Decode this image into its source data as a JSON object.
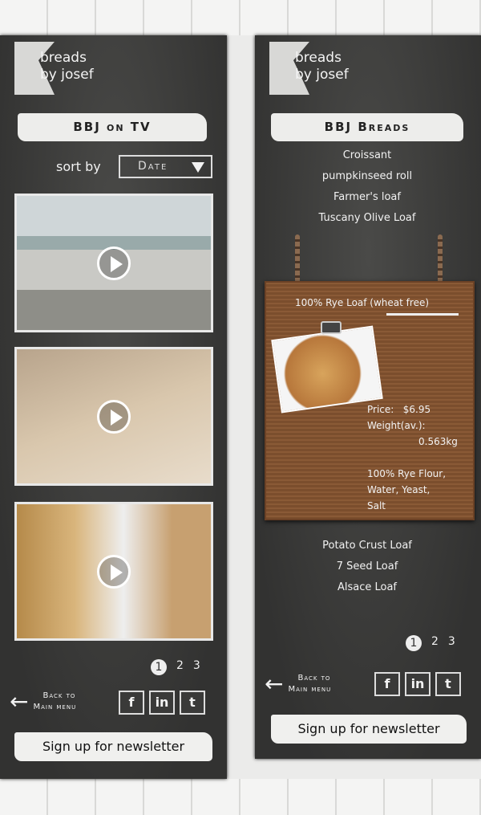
{
  "brand": {
    "line1": "breads",
    "line2": "by josef"
  },
  "screen_tv": {
    "title": "BBJ on TV",
    "sort_label": "sort by",
    "sort_value": "Date",
    "videos": [
      {
        "name": "bakers-kitchen"
      },
      {
        "name": "kneading-dough"
      },
      {
        "name": "baker-in-shop"
      }
    ],
    "pages": [
      "1",
      "2",
      "3"
    ],
    "back_line1": "Back to",
    "back_line2": "Main menu",
    "social": [
      "f",
      "in",
      "t"
    ],
    "newsletter": "Sign up for newsletter"
  },
  "screen_breads": {
    "title": "BBJ Breads",
    "list_top": [
      "Croissant",
      "pumpkinseed roll",
      "Farmer's loaf",
      "Tuscany Olive Loaf"
    ],
    "featured": {
      "name": "100% Rye Loaf (wheat free)",
      "price_label": "Price:",
      "price": "$6.95",
      "weight_label": "Weight(av.):",
      "weight": "0.563kg",
      "ingredients": [
        "100% Rye Flour,",
        "Water, Yeast,",
        "Salt"
      ]
    },
    "list_bottom": [
      "Potato Crust Loaf",
      "7 Seed Loaf",
      "Alsace Loaf"
    ],
    "pages": [
      "1",
      "2",
      "3"
    ],
    "back_line1": "Back to",
    "back_line2": "Main menu",
    "social": [
      "f",
      "in",
      "t"
    ],
    "newsletter": "Sign up for newsletter"
  }
}
